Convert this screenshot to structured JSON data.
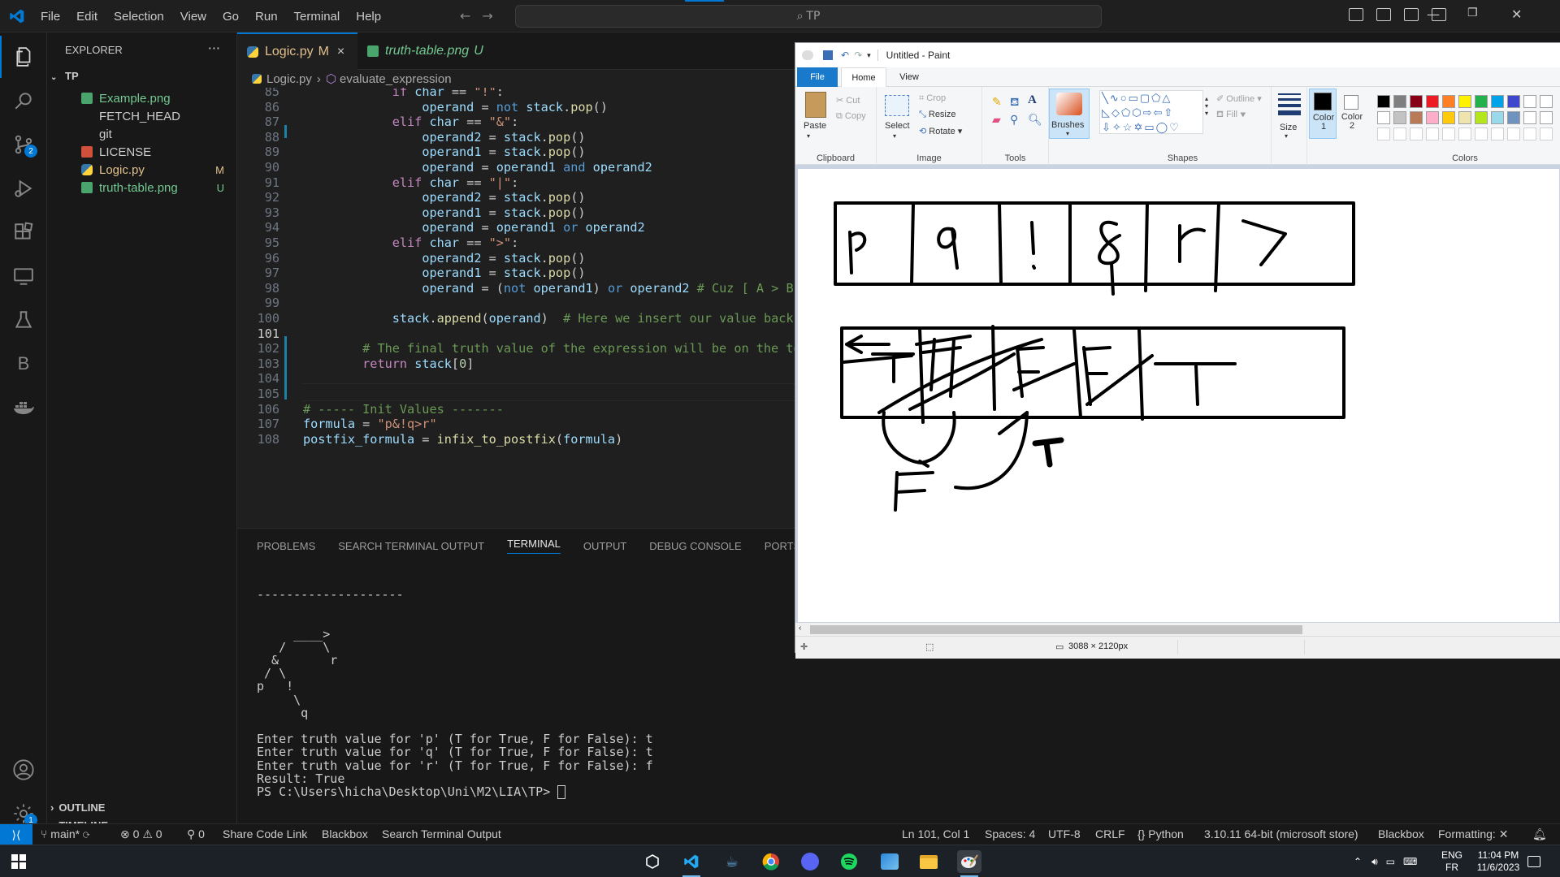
{
  "vscode": {
    "menu": [
      "File",
      "Edit",
      "Selection",
      "View",
      "Go",
      "Run",
      "Terminal",
      "Help"
    ],
    "search": "TP",
    "explorer_title": "EXPLORER",
    "root": "TP",
    "files": [
      {
        "name": "Example.png",
        "status": "",
        "color": "#73c991",
        "icon": "image-icon"
      },
      {
        "name": "FETCH_HEAD",
        "status": "",
        "color": "#cccccc",
        "icon": "file-icon"
      },
      {
        "name": "git",
        "status": "",
        "color": "#cccccc",
        "icon": "file-icon"
      },
      {
        "name": "LICENSE",
        "status": "",
        "color": "#cccccc",
        "icon": "license-icon"
      },
      {
        "name": "Logic.py",
        "status": "M",
        "color": "#e2c08d",
        "icon": "python-icon"
      },
      {
        "name": "truth-table.png",
        "status": "U",
        "color": "#73c991",
        "icon": "image-icon"
      }
    ],
    "outline": "OUTLINE",
    "timeline": "TIMELINE",
    "tabs": [
      {
        "label": "Logic.py",
        "status": "M",
        "close": "×"
      },
      {
        "label": "truth-table.png",
        "status": "U"
      }
    ],
    "breadcrumb": {
      "file": "Logic.py",
      "symbol": "evaluate_expression"
    },
    "source_control_badge": "2",
    "settings_badge": "1",
    "panel_tabs": [
      "PROBLEMS",
      "SEARCH TERMINAL OUTPUT",
      "TERMINAL",
      "OUTPUT",
      "DEBUG CONSOLE",
      "PORTS"
    ],
    "terminal_lines": [
      "--------------------",
      "",
      "",
      "     ____>",
      "   /     \\",
      "  &       r",
      " / \\",
      "p   !",
      "     \\",
      "      q",
      "",
      "Enter truth value for 'p' (T for True, F for False): t",
      "Enter truth value for 'q' (T for True, F for False): t",
      "Enter truth value for 'r' (T for True, F for False): f",
      "Result: True",
      "PS C:\\Users\\hicha\\Desktop\\Uni\\M2\\LIA\\TP> "
    ],
    "status": {
      "branch": "main*",
      "errors": "0",
      "warnings": "0",
      "ports": "0",
      "share": "Share Code Link",
      "blackbox": "Blackbox",
      "search_output": "Search Terminal Output",
      "position": "Ln 101, Col 1",
      "spaces": "Spaces: 4",
      "encoding": "UTF-8",
      "eol": "CRLF",
      "language": "Python",
      "interpreter": "3.10.11 64-bit (microsoft store)",
      "blackbox2": "Blackbox",
      "formatting": "Formatting: ✕"
    }
  },
  "code_lines": [
    {
      "n": 85,
      "html": "            <span class='kw'>if</span> <span class='vr'>char</span> == <span class='st'>\"!\"</span>:"
    },
    {
      "n": 86,
      "html": "                <span class='vr'>operand</span> = <span class='op'>not</span> <span class='vr'>stack</span>.<span class='fn'>pop</span>()"
    },
    {
      "n": 87,
      "html": "            <span class='kw'>elif</span> <span class='vr'>char</span> == <span class='st'>\"&amp;\"</span>:"
    },
    {
      "n": 88,
      "html": "                <span class='vr'>operand2</span> = <span class='vr'>stack</span>.<span class='fn'>pop</span>()"
    },
    {
      "n": 89,
      "html": "                <span class='vr'>operand1</span> = <span class='vr'>stack</span>.<span class='fn'>pop</span>()"
    },
    {
      "n": 90,
      "html": "                <span class='vr'>operand</span> = <span class='vr'>operand1</span> <span class='op'>and</span> <span class='vr'>operand2</span>"
    },
    {
      "n": 91,
      "html": "            <span class='kw'>elif</span> <span class='vr'>char</span> == <span class='st'>\"|\"</span>:"
    },
    {
      "n": 92,
      "html": "                <span class='vr'>operand2</span> = <span class='vr'>stack</span>.<span class='fn'>pop</span>()"
    },
    {
      "n": 93,
      "html": "                <span class='vr'>operand1</span> = <span class='vr'>stack</span>.<span class='fn'>pop</span>()"
    },
    {
      "n": 94,
      "html": "                <span class='vr'>operand</span> = <span class='vr'>operand1</span> <span class='op'>or</span> <span class='vr'>operand2</span>"
    },
    {
      "n": 95,
      "html": "            <span class='kw'>elif</span> <span class='vr'>char</span> == <span class='st'>\"&gt;\"</span>:"
    },
    {
      "n": 96,
      "html": "                <span class='vr'>operand2</span> = <span class='vr'>stack</span>.<span class='fn'>pop</span>()"
    },
    {
      "n": 97,
      "html": "                <span class='vr'>operand1</span> = <span class='vr'>stack</span>.<span class='fn'>pop</span>()"
    },
    {
      "n": 98,
      "html": "                <span class='vr'>operand</span> = (<span class='op'>not</span> <span class='vr'>operand1</span>) <span class='op'>or</span> <span class='vr'>operand2</span> <span class='cm'># Cuz [ A &gt; B</span>"
    },
    {
      "n": 99,
      "html": ""
    },
    {
      "n": 100,
      "html": "            <span class='vr'>stack</span>.<span class='fn'>append</span>(<span class='vr'>operand</span>)  <span class='cm'># Here we insert our value back</span>"
    },
    {
      "n": 101,
      "html": ""
    },
    {
      "n": 102,
      "html": "        <span class='cm'># The final truth value of the expression will be on the top o</span>"
    },
    {
      "n": 103,
      "html": "        <span class='kw'>return</span> <span class='vr'>stack</span>[<span class='st' style='color:#b5cea8'>0</span>]"
    },
    {
      "n": 104,
      "html": ""
    },
    {
      "n": 105,
      "html": ""
    },
    {
      "n": 106,
      "html": "<span class='cm'># ----- Init Values -------</span>"
    },
    {
      "n": 107,
      "html": "<span class='vr'>formula</span> = <span class='st'>\"p&amp;!q&gt;r\"</span>"
    },
    {
      "n": 108,
      "html": "<span class='vr'>postfix_formula</span> = <span class='fn'>infix_to_postfix</span>(<span class='vr'>formula</span>)"
    }
  ],
  "paint": {
    "title": "Untitled - Paint",
    "tabs": [
      "File",
      "Home",
      "View"
    ],
    "clipboard": {
      "paste": "Paste",
      "cut": "Cut",
      "copy": "Copy",
      "label": "Clipboard"
    },
    "image": {
      "select": "Select",
      "crop": "Crop",
      "resize": "Resize",
      "rotate": "Rotate",
      "label": "Image"
    },
    "tools_label": "Tools",
    "brushes": "Brushes",
    "shapes": {
      "outline": "Outline",
      "fill": "Fill",
      "label": "Shapes"
    },
    "size": "Size",
    "color1": "Color 1",
    "color2": "Color 2",
    "colors_label": "Colors",
    "dimensions": "3088 × 2120px",
    "palette_row1": [
      "#000000",
      "#7f7f7f",
      "#880015",
      "#ed1c24",
      "#ff7f27",
      "#fff200",
      "#22b14c",
      "#00a2e8",
      "#3f48cc"
    ],
    "palette_row2": [
      "#ffffff",
      "#c3c3c3",
      "#b97a57",
      "#ffaec9",
      "#ffc90e",
      "#efe4b0",
      "#b5e61d",
      "#99d9ea",
      "#7092be"
    ],
    "drawing_text_1": [
      "p",
      "q",
      "!",
      "&",
      "r",
      ">"
    ],
    "drawing_text_2": [
      "T",
      "F",
      "F",
      "F",
      "T"
    ],
    "drawing_text_3": [
      "F",
      "T"
    ]
  },
  "taskbar": {
    "lang": "ENG",
    "lang2": "FR",
    "time": "11:04 PM",
    "date": "11/6/2023"
  }
}
